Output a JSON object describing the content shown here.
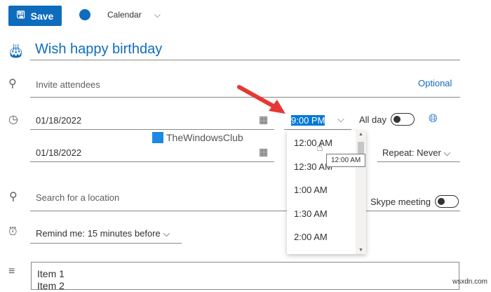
{
  "toolbar": {
    "save_label": "Save",
    "calendar_label": "Calendar",
    "calendar_color": "#0f6cbd"
  },
  "event": {
    "title": "Wish happy birthday",
    "attendees_placeholder": "Invite attendees",
    "optional_label": "Optional",
    "start_date": "01/18/2022",
    "start_time": "9:00 PM",
    "all_day_label": "All day",
    "end_date": "01/18/2022",
    "repeat_label": "Repeat:",
    "repeat_value": "Never",
    "location_placeholder": "Search for a location",
    "skype_label": "Skype meeting",
    "remind_label": "Remind me:",
    "remind_value": "15 minutes before",
    "body_lines": [
      "Item 1",
      "Item 2"
    ]
  },
  "time_dropdown": {
    "options": [
      "12:00 AM",
      "12:30 AM",
      "1:00 AM",
      "1:30 AM",
      "2:00 AM"
    ],
    "tooltip": "12:00 AM"
  },
  "watermarks": {
    "site": "TheWindowsClub",
    "corner": "wsxdn.com"
  }
}
